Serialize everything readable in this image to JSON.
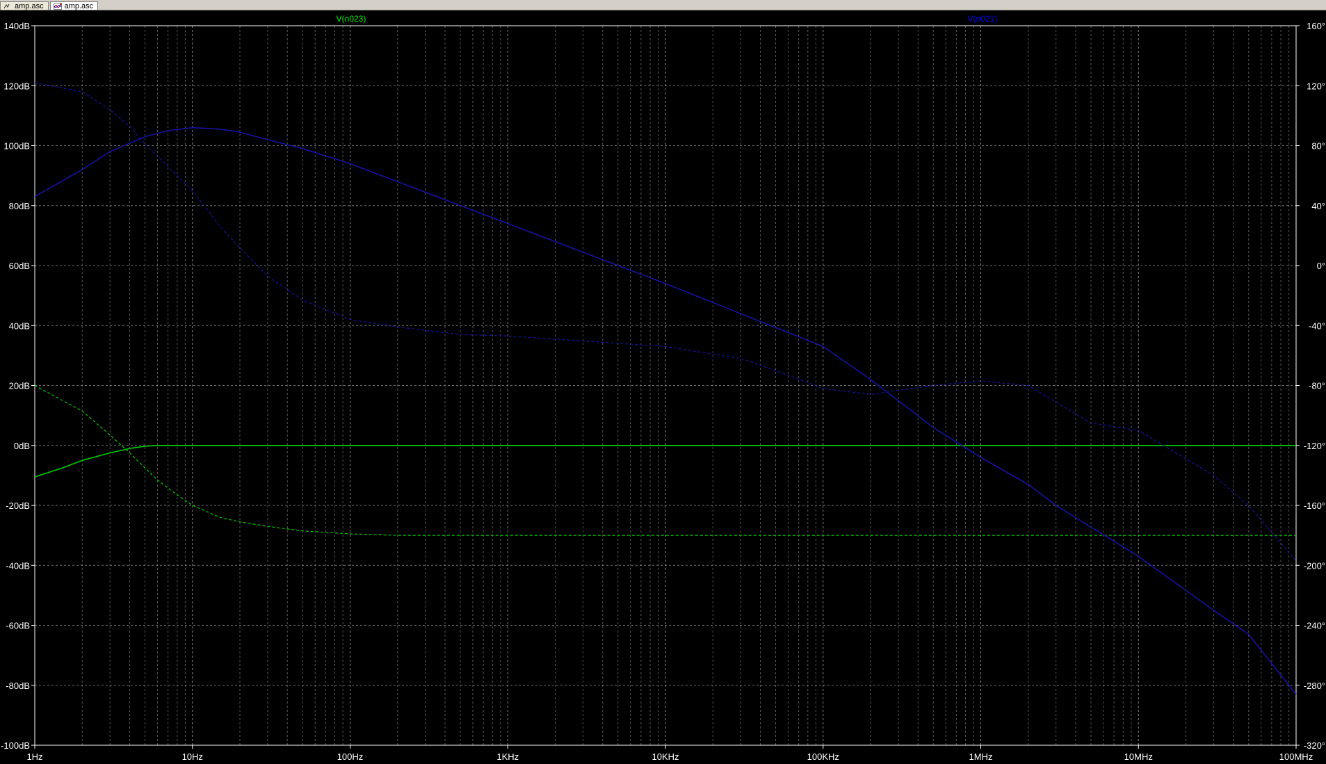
{
  "tabs": [
    {
      "label": "amp.asc",
      "icon": "schematic-icon",
      "active": false
    },
    {
      "label": "amp.asc",
      "icon": "waveform-icon",
      "active": true
    }
  ],
  "colors": {
    "background": "#000000",
    "grid": "#a0a0a0",
    "axis_text": "#ffffff",
    "trace_green": "#00d000",
    "trace_blue": "#1414a0",
    "label_green": "#00ff00",
    "label_blue": "#0000ff"
  },
  "chart_data": {
    "type": "line",
    "title": "",
    "x_scale": "log",
    "xlim": [
      1,
      100000000
    ],
    "ylim_left": [
      -100,
      140
    ],
    "ylim_right": [
      -320,
      160
    ],
    "x_ticks": [
      {
        "value": 1,
        "label": "1Hz"
      },
      {
        "value": 10,
        "label": "10Hz"
      },
      {
        "value": 100,
        "label": "100Hz"
      },
      {
        "value": 1000,
        "label": "1KHz"
      },
      {
        "value": 10000,
        "label": "10KHz"
      },
      {
        "value": 100000,
        "label": "100KHz"
      },
      {
        "value": 1000000,
        "label": "1MHz"
      },
      {
        "value": 10000000,
        "label": "10MHz"
      },
      {
        "value": 100000000,
        "label": "100MHz"
      }
    ],
    "y_ticks_left": [
      {
        "value": 140,
        "label": "140dB"
      },
      {
        "value": 120,
        "label": "120dB"
      },
      {
        "value": 100,
        "label": "100dB"
      },
      {
        "value": 80,
        "label": "80dB"
      },
      {
        "value": 60,
        "label": "60dB"
      },
      {
        "value": 40,
        "label": "40dB"
      },
      {
        "value": 20,
        "label": "20dB"
      },
      {
        "value": 0,
        "label": "0dB"
      },
      {
        "value": -20,
        "label": "-20dB"
      },
      {
        "value": -40,
        "label": "-40dB"
      },
      {
        "value": -60,
        "label": "-60dB"
      },
      {
        "value": -80,
        "label": "-80dB"
      },
      {
        "value": -100,
        "label": "-100dB"
      }
    ],
    "y_ticks_right": [
      {
        "value": 160,
        "label": "160°"
      },
      {
        "value": 120,
        "label": "120°"
      },
      {
        "value": 80,
        "label": "80°"
      },
      {
        "value": 40,
        "label": "40°"
      },
      {
        "value": 0,
        "label": "0°"
      },
      {
        "value": -40,
        "label": "-40°"
      },
      {
        "value": -80,
        "label": "-80°"
      },
      {
        "value": -120,
        "label": "-120°"
      },
      {
        "value": -160,
        "label": "-160°"
      },
      {
        "value": -200,
        "label": "-200°"
      },
      {
        "value": -240,
        "label": "-240°"
      },
      {
        "value": -280,
        "label": "-280°"
      },
      {
        "value": -320,
        "label": "-320°"
      }
    ],
    "grid": true,
    "series": [
      {
        "name": "V(n023)",
        "color": "#00d000",
        "label_color": "#00ff00",
        "magnitude_db": {
          "x": [
            1,
            1.5,
            2,
            3,
            4,
            5,
            6,
            8,
            10,
            100,
            1000,
            10000,
            100000,
            1000000,
            10000000,
            100000000
          ],
          "y": [
            -10.5,
            -7.5,
            -5,
            -2.5,
            -1,
            -0.3,
            0,
            0,
            0,
            0,
            0,
            0,
            0,
            0,
            0,
            0
          ]
        },
        "phase_deg": {
          "x": [
            1,
            1.5,
            2,
            3,
            4,
            5,
            6,
            8,
            10,
            15,
            20,
            30,
            50,
            100,
            200,
            500,
            1000,
            10000,
            100000,
            1000000,
            10000000,
            100000000
          ],
          "y": [
            -80,
            -90,
            -97,
            -113,
            -125,
            -135,
            -143,
            -153,
            -160,
            -168,
            -171,
            -174,
            -177,
            -179,
            -180,
            -180,
            -180,
            -180,
            -180,
            -180,
            -180,
            -180
          ]
        }
      },
      {
        "name": "V(n021)",
        "color": "#1414a0",
        "label_color": "#0000ff",
        "magnitude_db": {
          "x": [
            1,
            2,
            3,
            5,
            7,
            10,
            15,
            20,
            30,
            50,
            100,
            1000,
            10000,
            100000,
            200000,
            500000,
            1000000,
            2000000,
            3000000,
            10000000,
            30000000,
            50000000,
            100000000
          ],
          "y": [
            83,
            92,
            98,
            103,
            105,
            106,
            105.5,
            104.5,
            102,
            99,
            94,
            74,
            54,
            33,
            22,
            6,
            -4,
            -13,
            -20,
            -37,
            -55,
            -63,
            -83
          ]
        },
        "phase_deg": {
          "x": [
            1,
            2,
            3,
            4,
            5,
            7,
            10,
            15,
            20,
            30,
            50,
            100,
            200,
            500,
            1000,
            10000,
            30000,
            50000,
            100000,
            200000,
            500000,
            1000000,
            2000000,
            5000000,
            10000000,
            30000000,
            50000000,
            100000000
          ],
          "y": [
            122,
            116,
            104,
            93,
            81,
            66,
            50,
            26,
            12,
            -7,
            -23,
            -36,
            -41,
            -46,
            -47,
            -54,
            -62,
            -70,
            -82,
            -86,
            -80,
            -77,
            -80,
            -105,
            -110,
            -140,
            -160,
            -197
          ]
        }
      }
    ]
  }
}
